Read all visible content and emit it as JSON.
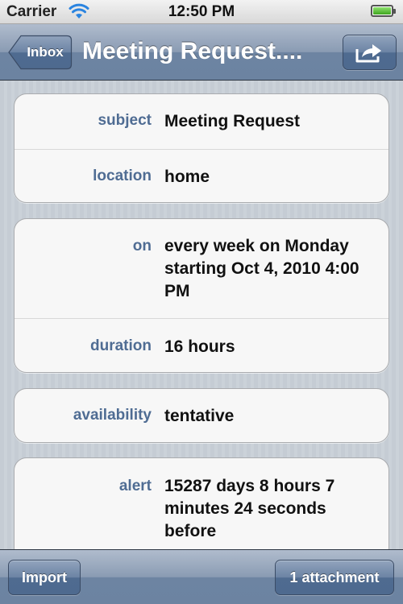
{
  "status_bar": {
    "carrier": "Carrier",
    "time": "12:50 PM",
    "icons": [
      "wifi-icon",
      "battery-icon"
    ]
  },
  "nav_bar": {
    "back_label": "Inbox",
    "title": "Meeting Request....",
    "action_icon": "share-icon"
  },
  "event": {
    "subject": {
      "label": "subject",
      "value": "Meeting Request"
    },
    "location": {
      "label": "location",
      "value": "home"
    },
    "on": {
      "label": "on",
      "value": "every week on Monday starting Oct 4, 2010 4:00 PM"
    },
    "duration": {
      "label": "duration",
      "value": "16 hours"
    },
    "availability": {
      "label": "availability",
      "value": "tentative"
    },
    "alert": {
      "label": "alert",
      "value": "15287 days 8 hours 7 minutes 24 seconds before"
    }
  },
  "toolbar": {
    "import_label": "Import",
    "attachment_label": "1 attachment"
  },
  "colors": {
    "nav_blue": "#6d84a2",
    "label_blue": "#4f6c93",
    "background": "#c5ccd4"
  }
}
